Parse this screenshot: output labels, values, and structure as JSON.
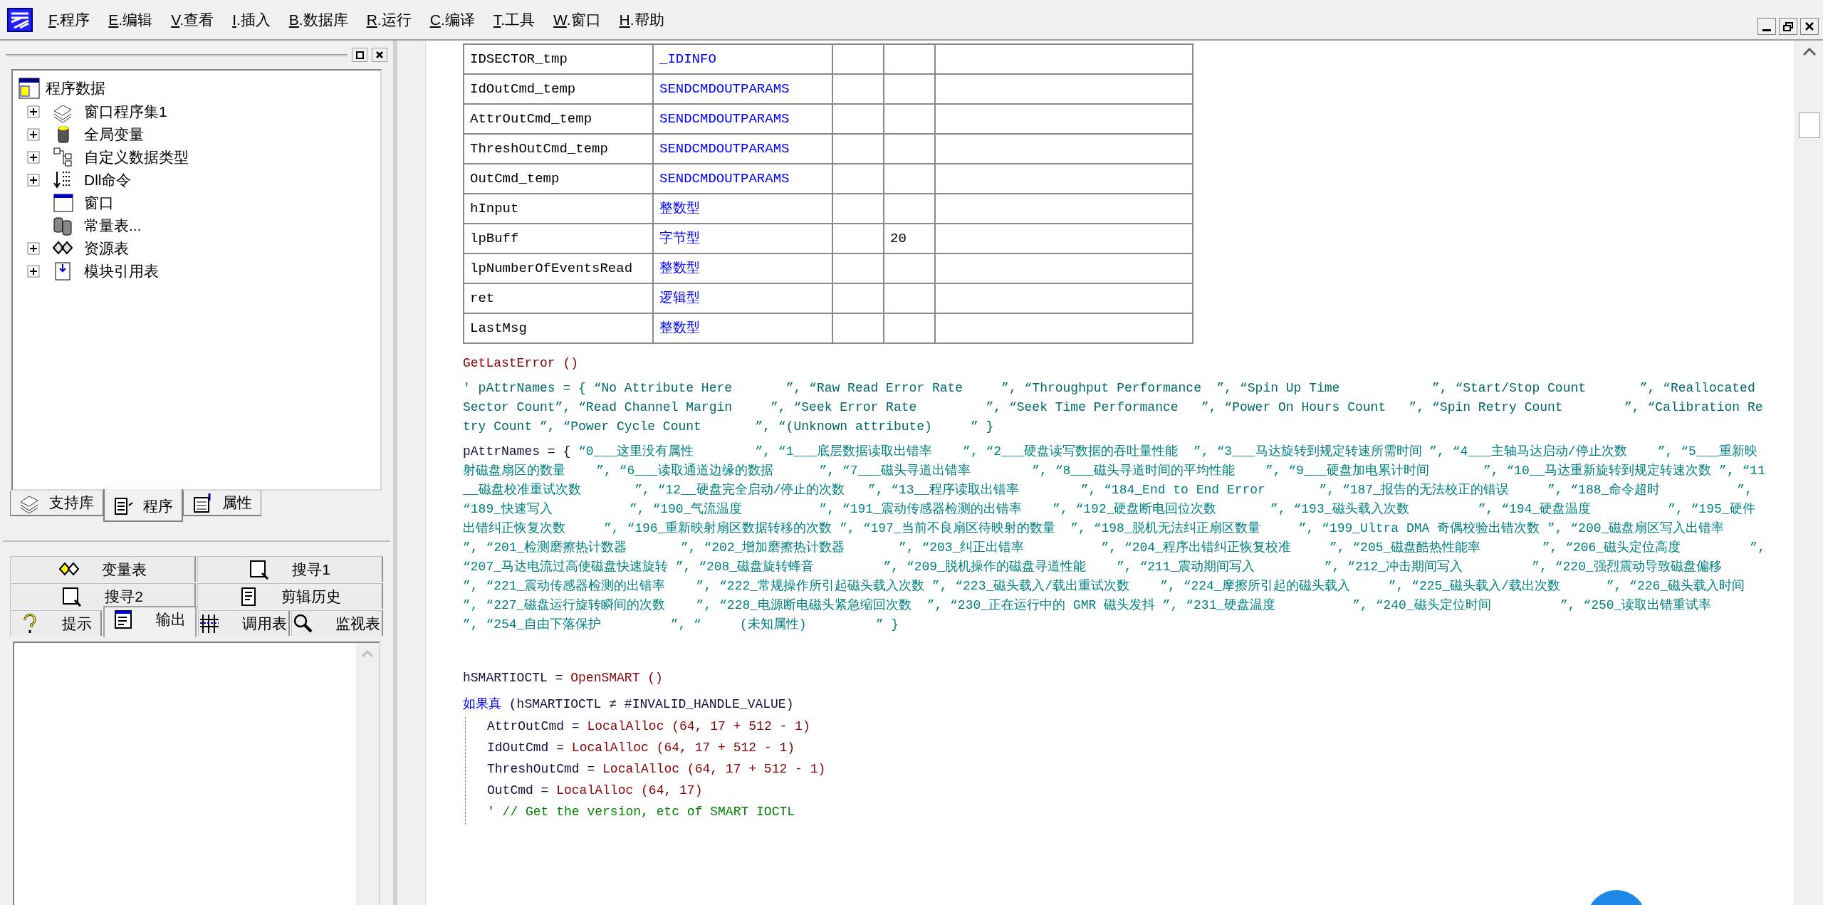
{
  "menu_bar": {
    "items": [
      "F.程序",
      "E.编辑",
      "V.查看",
      "I.插入",
      "B.数据库",
      "R.运行",
      "C.编译",
      "T.工具",
      "W.窗口",
      "H.帮助"
    ]
  },
  "project_tree": {
    "root": "程序数据",
    "children": [
      {
        "label": "窗口程序集1",
        "expandable": true
      },
      {
        "label": "全局变量",
        "expandable": true
      },
      {
        "label": "自定义数据类型",
        "expandable": true
      },
      {
        "label": "Dll命令",
        "expandable": true
      },
      {
        "label": "窗口",
        "expandable": false
      },
      {
        "label": "常量表...",
        "expandable": false
      },
      {
        "label": "资源表",
        "expandable": true
      },
      {
        "label": "模块引用表",
        "expandable": true
      }
    ]
  },
  "panel_tabs": [
    {
      "label": "支持库",
      "selected": false
    },
    {
      "label": "程序",
      "selected": true
    },
    {
      "label": "属性",
      "selected": false
    }
  ],
  "output_tabs": {
    "rows": [
      [
        {
          "label": "变量表",
          "selected": false
        },
        {
          "label": "搜寻1",
          "selected": false
        }
      ],
      [
        {
          "label": "搜寻2",
          "selected": false
        },
        {
          "label": "剪辑历史",
          "selected": false
        }
      ],
      [
        {
          "label": "提示",
          "selected": false
        },
        {
          "label": "输出",
          "selected": true
        },
        {
          "label": "调用表",
          "selected": false
        },
        {
          "label": "监视表",
          "selected": false
        }
      ]
    ]
  },
  "variable_table": {
    "rows": [
      [
        "IDSECTOR_tmp",
        "_IDINFO",
        "",
        ""
      ],
      [
        "IdOutCmd_temp",
        "SENDCMDOUTPARAMS",
        "",
        ""
      ],
      [
        "AttrOutCmd_temp",
        "SENDCMDOUTPARAMS",
        "",
        ""
      ],
      [
        "ThreshOutCmd_temp",
        "SENDCMDOUTPARAMS",
        "",
        ""
      ],
      [
        "OutCmd_temp",
        "SENDCMDOUTPARAMS",
        "",
        ""
      ],
      [
        "hInput",
        "整数型",
        "",
        ""
      ],
      [
        "lpBuff",
        "字节型",
        "",
        "20"
      ],
      [
        "lpNumberOfEventsRead",
        "整数型",
        "",
        ""
      ],
      [
        "ret",
        "逻辑型",
        "",
        ""
      ],
      [
        "LastMsg",
        "整数型",
        "",
        ""
      ]
    ]
  },
  "code_sections": [
    {
      "lines": [
        {
          "segments": [
            {
              "kind": "call",
              "text": "GetLastError ()"
            }
          ]
        },
        {
          "segments": [
            {
              "kind": "comment",
              "text": "' pAttrNames = { “No Attribute Here       ”, “Raw Read Error Rate     ”, “Throughput Performance  ”, “Spin Up Time            ”, “Start/Stop Count       ”, “Reallocated Sector Count”, “Read Channel Margin     ”, “Seek Error Rate         ”, “Seek Time Performance   ”, “Power On Hours Count   ”, “Spin Retry Count        ”, “Calibration Retry Count ”, “Power Cycle Count       ”, “(Unknown attribute)     ” }"
            }
          ]
        },
        {
          "segments": [
            {
              "kind": "plain",
              "text": "pAttrNames = { "
            },
            {
              "kind": "string",
              "text": "“0___这里没有属性        ”, “1___底层数据读取出错率    ”, “2___硬盘读写数据的吞吐量性能  ”, “3___马达旋转到规定转速所需时间 ”, “4___主轴马达启动/停止次数    ”, “5___重新映射磁盘扇区的数量    ”, “6___读取通道边缘的数据      ”, “7___磁头寻道出错率        ”, “8___磁头寻道时间的平均性能    ”, “9___硬盘加电累计时间       ”, “10__马达重新旋转到规定转速次数 ”, “11__磁盘校准重试次数       ”, “12__硬盘完全启动/停止的次数   ”, “13__程序读取出错率        ”, “184_End to End Error       ”, “187_报告的无法校正的错误     ”, “188_命令超时          ”, “189_快速写入          ”, “190_气流温度          ”, “191_震动传感器检测的出错率    ”, “192_硬盘断电回位次数       ”, “193_磁头载入次数         ”, “194_硬盘温度          ”, “195_硬件出错纠正恢复次数     ”, “196_重新映射扇区数据转移的次数 ”, “197_当前不良扇区待映射的数量  ”, “198_脱机无法纠正扇区数量     ”, “199_Ultra DMA 奇偶校验出错次数 ”, “200_磁盘扇区写入出错率      ”, “201_检测磨擦热计数器       ”, “202_增加磨擦热计数器       ”, “203_纠正出错率          ”, “204_程序出错纠正恢复校准     ”, “205_磁盘酷热性能率        ”, “206_磁头定位高度         ”, “207_马达电流过高使磁盘快速旋转 ”, “208_磁盘旋转蜂音         ”, “209_脱机操作的磁盘寻道性能    ”, “211_震动期间写入         ”, “212_冲击期间写入         ”, “220_强烈震动导致磁盘偏移     ”, “221_震动传感器检测的出错率    ”, “222_常规操作所引起磁头载入次数 ”, “223_磁头载入/载出重试次数    ”, “224_摩擦所引起的磁头载入     ”, “225_磁头载入/载出次数      ”, “226_磁头载入时间         ”, “227_磁盘运行旋转瞬间的次数    ”, “228_电源断电磁头紧急缩回次数  ”, “230_正在运行中的 GMR 磁头发抖 ”, “231_硬盘温度          ”, “240_磁头定位时间         ”, “250_读取出错重试率        ”, “254_自由下落保护         ”, “     (未知属性)         ” }"
            }
          ]
        }
      ]
    },
    {
      "lines": [
        {
          "segments": [
            {
              "kind": "plain",
              "text": "hSMARTIOCTL = "
            },
            {
              "kind": "call",
              "text": "OpenSMART ()"
            }
          ]
        },
        {
          "segments": [
            {
              "kind": "keyword",
              "text": "如果真"
            },
            {
              "kind": "plain",
              "text": " (hSMARTIOCTL ≠ #INVALID_HANDLE_VALUE)"
            }
          ],
          "children": [
            {
              "segments": [
                {
                  "kind": "plain",
                  "text": "AttrOutCmd = "
                },
                {
                  "kind": "call",
                  "text": "LocalAlloc (64, 17 + 512 - 1)"
                }
              ]
            },
            {
              "segments": [
                {
                  "kind": "plain",
                  "text": "IdOutCmd = "
                },
                {
                  "kind": "call",
                  "text": "LocalAlloc (64, 17 + 512 - 1)"
                }
              ]
            },
            {
              "segments": [
                {
                  "kind": "plain",
                  "text": "ThreshOutCmd = "
                },
                {
                  "kind": "call",
                  "text": "LocalAlloc (64, 17 + 512 - 1)"
                }
              ]
            },
            {
              "segments": [
                {
                  "kind": "plain",
                  "text": "OutCmd = "
                },
                {
                  "kind": "call",
                  "text": "LocalAlloc (64, 17)"
                }
              ]
            },
            {
              "segments": [
                {
                  "kind": "note",
                  "text": "' // Get the version, etc of SMART IOCTL"
                }
              ]
            }
          ]
        }
      ]
    }
  ]
}
